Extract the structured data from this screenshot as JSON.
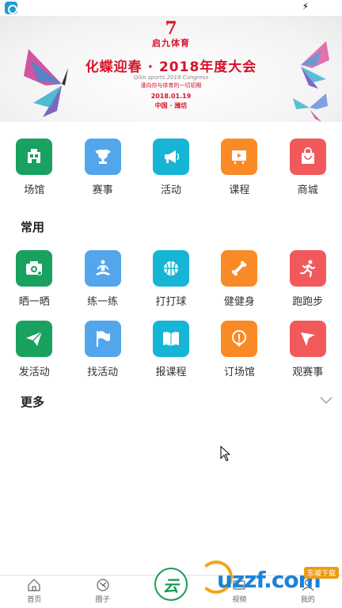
{
  "banner": {
    "brand_mark": "7",
    "brand_name": "启九体育",
    "title": "化蝶迎春 · 2018年度大会",
    "subtitle_en": "Qilin sports 2018 Congress",
    "subtitle_cn": "谨向你与体育的一切初期",
    "date": "2018.01.19",
    "place": "中国 · 潍坊"
  },
  "top_grid": [
    {
      "label": "场馆",
      "icon": "venue-icon",
      "color": "#19a15f"
    },
    {
      "label": "赛事",
      "icon": "trophy-icon",
      "color": "#53a6ec"
    },
    {
      "label": "活动",
      "icon": "megaphone-icon",
      "color": "#16b5d6"
    },
    {
      "label": "课程",
      "icon": "video-course-icon",
      "color": "#fa8a25"
    },
    {
      "label": "商城",
      "icon": "shopping-bag-icon",
      "color": "#f1595b"
    }
  ],
  "common": {
    "title": "常用",
    "row1": [
      {
        "label": "晒一晒",
        "icon": "camera-icon",
        "color": "#19a15f"
      },
      {
        "label": "练一练",
        "icon": "meditation-icon",
        "color": "#53a6ec"
      },
      {
        "label": "打打球",
        "icon": "basketball-icon",
        "color": "#16b5d6"
      },
      {
        "label": "健健身",
        "icon": "dumbbell-icon",
        "color": "#fa8a25"
      },
      {
        "label": "跑跑步",
        "icon": "runner-icon",
        "color": "#f1595b"
      }
    ],
    "row2": [
      {
        "label": "发活动",
        "icon": "paper-plane-icon",
        "color": "#19a15f"
      },
      {
        "label": "找活动",
        "icon": "flag-icon",
        "color": "#53a6ec"
      },
      {
        "label": "报课程",
        "icon": "book-icon",
        "color": "#16b5d6"
      },
      {
        "label": "订场馆",
        "icon": "location-pin-icon",
        "color": "#fa8a25"
      },
      {
        "label": "观赛事",
        "icon": "pennant-icon",
        "color": "#f1595b"
      }
    ]
  },
  "more": {
    "title": "更多"
  },
  "tabbar": [
    {
      "label": "首页",
      "icon": "home-icon"
    },
    {
      "label": "圈子",
      "icon": "circle-icon"
    },
    {
      "label": "",
      "icon": "cloud-center-icon",
      "center_glyph": "云"
    },
    {
      "label": "视频",
      "icon": "video-icon"
    },
    {
      "label": "我的",
      "icon": "profile-icon"
    }
  ],
  "watermark": {
    "text": "uzzf.com",
    "tag": "东坡下载"
  }
}
